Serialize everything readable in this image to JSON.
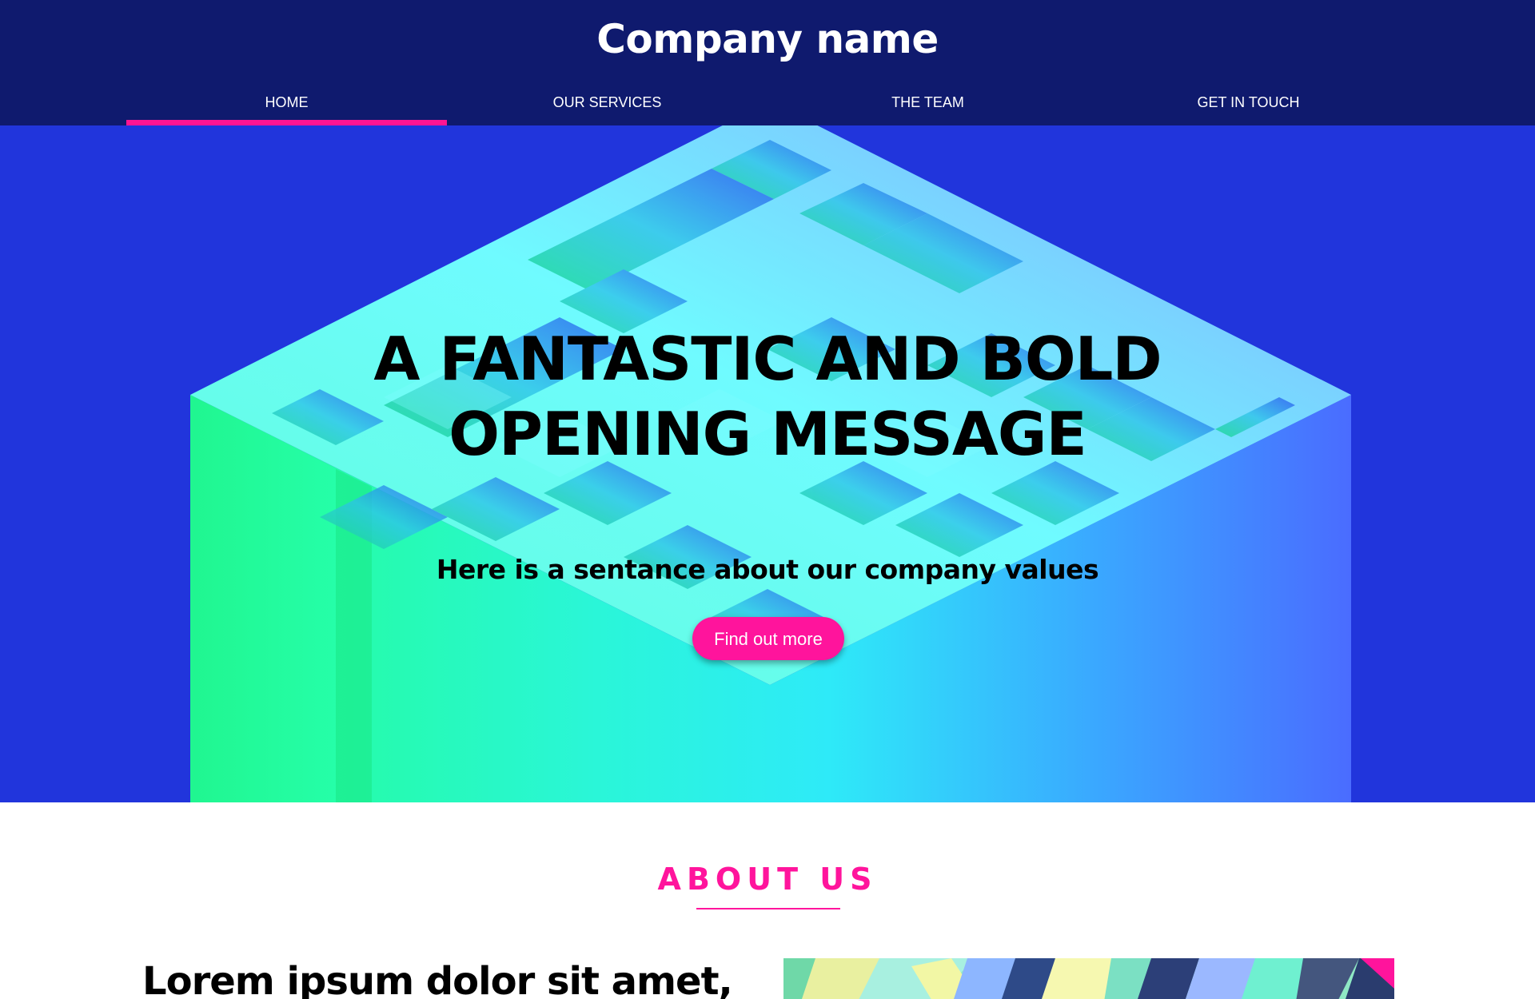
{
  "header": {
    "brand": "Company name"
  },
  "nav": {
    "items": [
      {
        "label": "HOME",
        "active": true
      },
      {
        "label": "OUR SERVICES",
        "active": false
      },
      {
        "label": "THE TEAM",
        "active": false
      },
      {
        "label": "GET IN TOUCH",
        "active": false
      }
    ]
  },
  "hero": {
    "headline_line1": "A FANTASTIC AND BOLD",
    "headline_line2": "OPENING MESSAGE",
    "subheading": "Here is a sentance about our company values",
    "cta_label": "Find out more"
  },
  "about": {
    "title": "ABOUT US",
    "heading": "Lorem ipsum dolor sit amet,"
  },
  "colors": {
    "header_bg": "#0f1a6e",
    "hero_bg": "#2135dc",
    "accent": "#ff149c",
    "maze_green": "#22ff99",
    "maze_cyan": "#2ff0f5",
    "maze_blue": "#4a6cff"
  }
}
